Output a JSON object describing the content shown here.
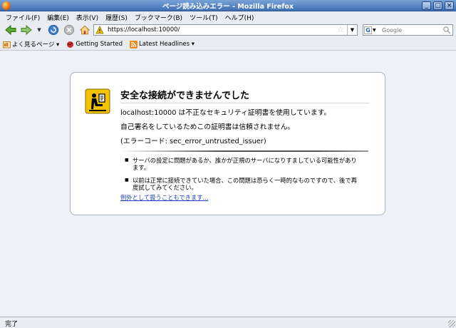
{
  "window": {
    "title": "ページ読み込みエラー - Mozilla Firefox",
    "buttons": [
      "_",
      "□",
      "×"
    ]
  },
  "menu": [
    "ファイル(F)",
    "編集(E)",
    "表示(V)",
    "履歴(S)",
    "ブックマーク(B)",
    "ツール(T)",
    "ヘルプ(H)"
  ],
  "navbar": {
    "url": "https://localhost:10000/",
    "search_placeholder": "Google",
    "search_engine": "G"
  },
  "bookmarks": [
    {
      "label": "よく見るページ ▾",
      "icon": "most-visited-icon"
    },
    {
      "label": "Getting Started",
      "icon": "getting-started-icon"
    },
    {
      "label": "Latest Headlines ▾",
      "icon": "rss-icon"
    }
  ],
  "error": {
    "title": "安全な接続ができませんでした",
    "line1": "localhost:10000 は不正なセキュリティ証明書を使用しています。",
    "line2": "自己署名をしているためこの証明書は信頼されません。",
    "code": "(エラーコード: sec_error_untrusted_issuer)",
    "bullets": [
      "サーバの設定に問題があるか、誰かが正規のサーバになりすましている可能性があります。",
      "以前は正常に接続できていた場合、この問題は恐らく一時的なものですので、後で再度試してみてください。"
    ],
    "exception_link": "例外として扱うこともできます..."
  },
  "status": {
    "text": "完了"
  },
  "colors": {
    "accent": "#3f6fb3",
    "link": "#1a3fc4"
  }
}
